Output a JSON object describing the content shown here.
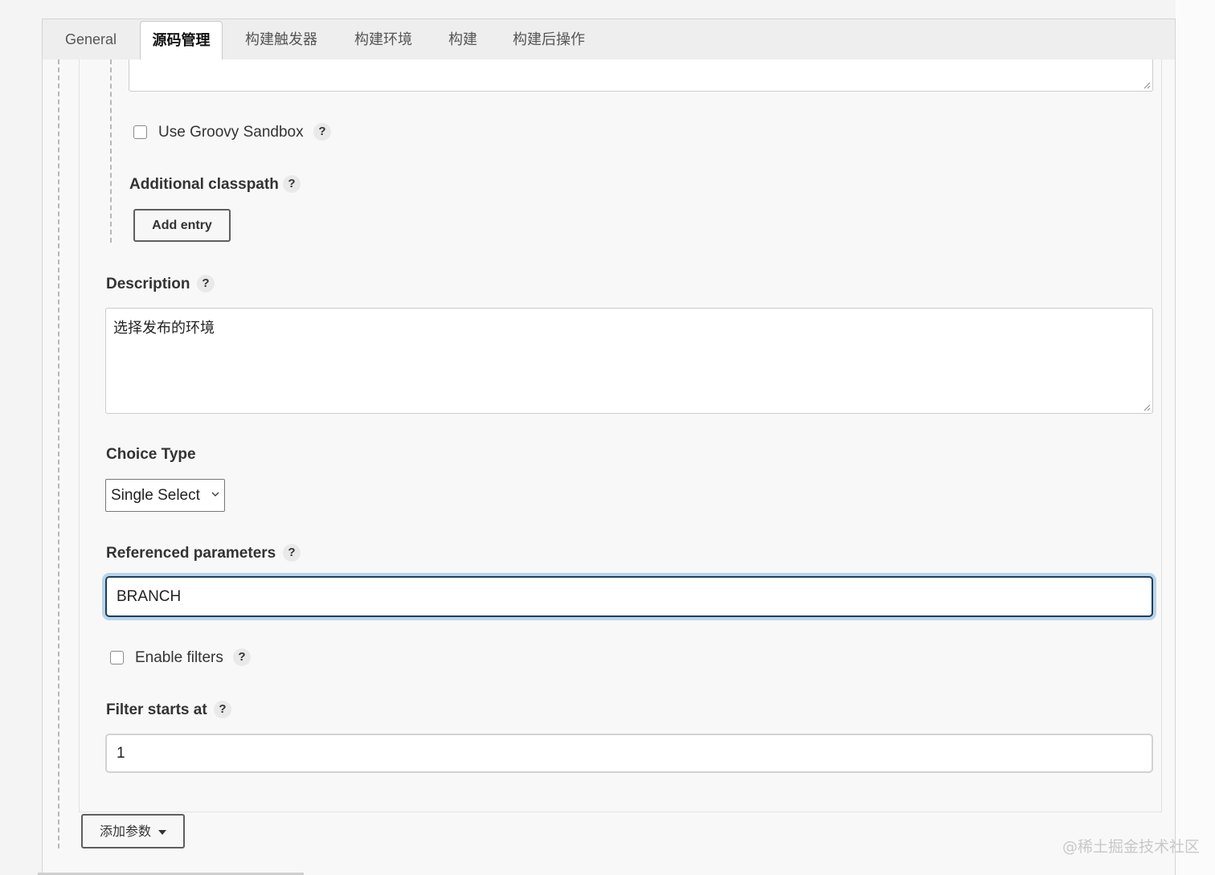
{
  "tabs": [
    {
      "label": "General",
      "active": false
    },
    {
      "label": "源码管理",
      "active": true
    },
    {
      "label": "构建触发器",
      "active": false
    },
    {
      "label": "构建环境",
      "active": false
    },
    {
      "label": "构建",
      "active": false
    },
    {
      "label": "构建后操作",
      "active": false
    }
  ],
  "sandbox": {
    "label": "Use Groovy Sandbox",
    "checked": false
  },
  "classpath": {
    "label": "Additional classpath",
    "button": "Add entry"
  },
  "description": {
    "label": "Description",
    "value": "选择发布的环境"
  },
  "choice_type": {
    "label": "Choice Type",
    "selected": "Single Select"
  },
  "referenced_parameters": {
    "label": "Referenced parameters",
    "value": "BRANCH"
  },
  "filters": {
    "label": "Enable filters",
    "checked": false
  },
  "filter_start": {
    "label": "Filter starts at",
    "value": "1"
  },
  "add_param": {
    "label": "添加参数"
  },
  "help_symbol": "?",
  "watermark": "@稀土掘金技术社区",
  "colors": {
    "focus_border": "#1f3d5c",
    "focus_ring": "#b9d4ea"
  }
}
